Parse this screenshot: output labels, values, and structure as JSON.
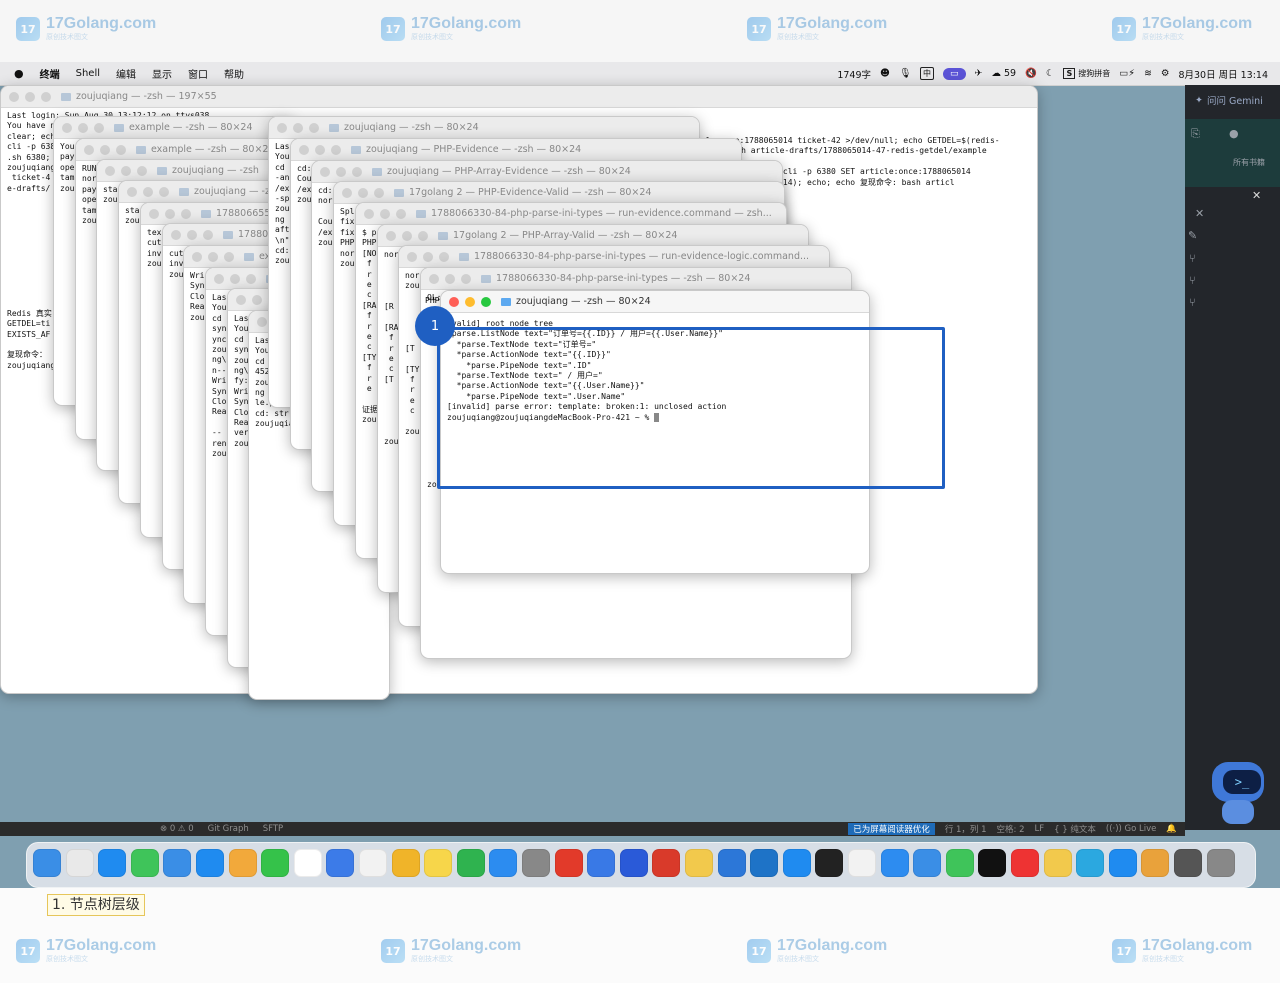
{
  "watermark": {
    "text": "17Golang.com",
    "sub": "原创技术图文",
    "logo": "17"
  },
  "menubar": {
    "items": [
      "终端",
      "Shell",
      "编辑",
      "显示",
      "窗口",
      "帮助"
    ],
    "word_count": "1749字",
    "ime_label": "中",
    "weather": "59",
    "sogou": "搜狗拼音",
    "datetime": "8月30日 周日 13:14"
  },
  "gemini": {
    "label": "问问 Gemini",
    "sub": "所有书籍"
  },
  "statusbar": {
    "left": [
      "⊗ 0 ⚠ 0",
      "Git Graph",
      "SFTP"
    ],
    "highlight": "已为屏幕阅读器优化",
    "position": "行 1，列 1",
    "spaces": "空格: 2",
    "eol": "LF",
    "lang": "{ } 纯文本",
    "live": "((·)) Go Live"
  },
  "windows": [
    {
      "title": "zoujuqiang — -zsh — 197×55",
      "body": "Last login: Sun Aug 30 13:12:12 on ttys038\nYou have new mail.\nclear; echo\ncli -p 638\n.sh 6380;\nzoujuqiang@\n ticket-4\ne-drafts/\n\n\n\n\n\n\n\n\n\n\n\nRedis 真实\nGETDEL=ti\nEXISTS_AF\n\n复现命令：\nzoujuqiang"
    },
    {
      "title": "example — -zsh — 80×24",
      "body": "You\npay\nope\ntam\nzou"
    },
    {
      "title": "example — -zsh — 80×24",
      "body": "RUN\nnor\npay\nope\ntam\nzou"
    },
    {
      "title": "zoujuqiang — -zsh",
      "body": "sta\nzou"
    },
    {
      "title": "zoujuqiang — -z",
      "body": "sta\nzou"
    },
    {
      "title": "178806655",
      "body": "tex\ncut\ninv\nzou"
    },
    {
      "title": "17880",
      "body": "cut\ninv\nzou"
    },
    {
      "title": "ex",
      "body": "Wri\nSyn\nClo\nRea\nzou"
    },
    {
      "title": "",
      "body": "Las\nYou\ncd\nsyn\nync\nzou\nng\\\nn--\nWri\nSyn\nClo\nRea\n\n--\nren\nzou"
    },
    {
      "title": "",
      "body": "Las\nYou\ncd\nsyn\nzou\nng\\\nfy:\nWri\nSyn\nClo\nRea\nver\nzou"
    },
    {
      "title": "",
      "body": "Las\nYou\ncd\n452\nzou\nng\nle.php\ncd: str\nzoujuqiang@"
    },
    {
      "title": "zoujuqiang — -zsh — 80×24",
      "body": "Las\nYou\ncd\n-an\n/ex\n-sp\nzou\nng\naft\n\\n\"\ncd:\nzou"
    },
    {
      "title": "zoujuqiang — PHP-Evidence — -zsh — 80×24",
      "body": "cd:\nCou\n/ex\nzou"
    },
    {
      "title": "zoujuqiang — PHP-Array-Evidence — -zsh — 80×24",
      "body": "cd:\nnor\n\nCou\n/ex\nzou"
    },
    {
      "title": "17golang 2 — PHP-Evidence-Valid — -zsh — 80×24",
      "body": "Spl\nfix\nfix\nPHP\nnor\nzou"
    },
    {
      "title": "1788066330-84-php-parse-ini-types — run-evidence.command — zsh...",
      "body": "$ p\nPHP\n[NO\n f\n r\n e\n c\n[RA\n f\n r\n e\n c\n[TY\n f\n r\n e\n\n证据\nzou"
    },
    {
      "title": "17golang 2 — PHP-Array-Valid — -zsh — 80×24",
      "body": "nor\n\n\n\n\n[R\n\n[RA\n f\n r\n e\n c\n[T\n\n\n\n\n\nzou"
    },
    {
      "title": "1788066330-84-php-parse-ini-types — run-evidence-logic.command...",
      "body": "nor\nzou\n\n\n\n\n\n[T\n\n[TY\n f\n r\n e\n c\n\nzou"
    },
    {
      "title": "1788066330-84-php-parse-ini-types — -zsh — 80×24",
      "body": "OL;\n\n$ p\nte\n[N\n\n\n\n\n\n\n\n\n\n\n\n\n\nzou"
    }
  ],
  "background_log": {
    "line1": "-le:once:1788065014 ticket-42 >/dev/null; echo GETDEL=$(redis-",
    "line2": "命令: bash article-drafts/1788065014-47-redis-getdel/example",
    "line3": "/dev/null; redis-cli -p 6380 SET article:once:1788065014",
    "line4": "-le:once:1788065014); echo; echo 复现命令: bash articl"
  },
  "front_window": {
    "title": "zoujuqiang — -zsh — 80×24",
    "lines": [
      "[valid] root node tree",
      "*parse.ListNode text=\"订单号={{.ID}} / 用户={{.User.Name}}\"",
      "  *parse.TextNode text=\"订单号=\"",
      "  *parse.ActionNode text=\"{{.ID}}\"",
      "    *parse.PipeNode text=\".ID\"",
      "  *parse.TextNode text=\" / 用户=\"",
      "  *parse.ActionNode text=\"{{.User.Name}}\"",
      "    *parse.PipeNode text=\".User.Name\"",
      "[invalid] parse error: template: broken:1: unclosed action",
      "zoujuqiang@zoujuqiangdeMacBook-Pro-421 ~ % "
    ],
    "side_label": "PHP"
  },
  "highlight": {
    "badge": "1"
  },
  "caption": "1. 节点树层级"
}
